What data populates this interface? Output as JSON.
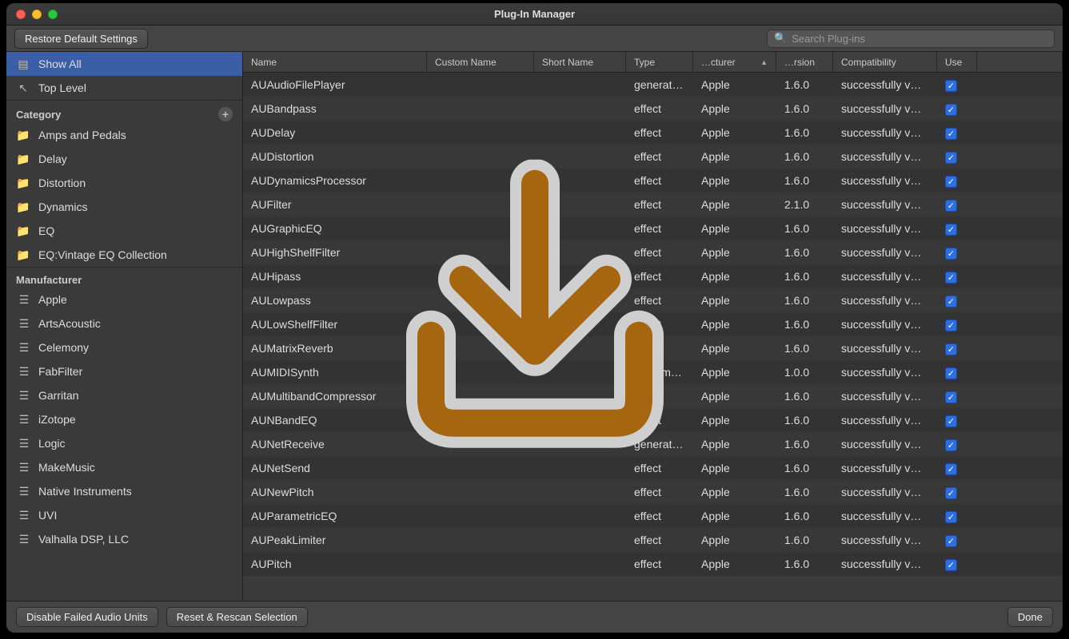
{
  "window": {
    "title": "Plug-In Manager"
  },
  "toolbar": {
    "restore_label": "Restore Default Settings",
    "search_placeholder": "Search Plug-ins"
  },
  "sidebar": {
    "top": [
      {
        "label": "Show All",
        "icon": "card-icon"
      },
      {
        "label": "Top Level",
        "icon": "up-arrow-icon"
      }
    ],
    "category_header": "Category",
    "categories": [
      "Amps and Pedals",
      "Delay",
      "Distortion",
      "Dynamics",
      "EQ",
      "EQ:Vintage EQ Collection"
    ],
    "manufacturer_header": "Manufacturer",
    "manufacturers": [
      "Apple",
      "ArtsAcoustic",
      "Celemony",
      "FabFilter",
      "Garritan",
      "iZotope",
      "Logic",
      "MakeMusic",
      "Native Instruments",
      "UVI",
      "Valhalla DSP, LLC"
    ]
  },
  "columns": {
    "name": "Name",
    "custom": "Custom Name",
    "short": "Short Name",
    "type": "Type",
    "man": "…cturer",
    "ver": "…rsion",
    "compat": "Compatibility",
    "use": "Use"
  },
  "rows": [
    {
      "name": "AUAudioFilePlayer",
      "type": "generat…",
      "man": "Apple",
      "ver": "1.6.0",
      "compat": "successfully v…",
      "use": true
    },
    {
      "name": "AUBandpass",
      "type": "effect",
      "man": "Apple",
      "ver": "1.6.0",
      "compat": "successfully v…",
      "use": true
    },
    {
      "name": "AUDelay",
      "type": "effect",
      "man": "Apple",
      "ver": "1.6.0",
      "compat": "successfully v…",
      "use": true
    },
    {
      "name": "AUDistortion",
      "type": "effect",
      "man": "Apple",
      "ver": "1.6.0",
      "compat": "successfully v…",
      "use": true
    },
    {
      "name": "AUDynamicsProcessor",
      "type": "effect",
      "man": "Apple",
      "ver": "1.6.0",
      "compat": "successfully v…",
      "use": true
    },
    {
      "name": "AUFilter",
      "type": "effect",
      "man": "Apple",
      "ver": "2.1.0",
      "compat": "successfully v…",
      "use": true
    },
    {
      "name": "AUGraphicEQ",
      "type": "effect",
      "man": "Apple",
      "ver": "1.6.0",
      "compat": "successfully v…",
      "use": true
    },
    {
      "name": "AUHighShelfFilter",
      "type": "effect",
      "man": "Apple",
      "ver": "1.6.0",
      "compat": "successfully v…",
      "use": true
    },
    {
      "name": "AUHipass",
      "type": "effect",
      "man": "Apple",
      "ver": "1.6.0",
      "compat": "successfully v…",
      "use": true
    },
    {
      "name": "AULowpass",
      "type": "effect",
      "man": "Apple",
      "ver": "1.6.0",
      "compat": "successfully v…",
      "use": true
    },
    {
      "name": "AULowShelfFilter",
      "type": "effect",
      "man": "Apple",
      "ver": "1.6.0",
      "compat": "successfully v…",
      "use": true
    },
    {
      "name": "AUMatrixReverb",
      "type": "effect",
      "man": "Apple",
      "ver": "1.6.0",
      "compat": "successfully v…",
      "use": true
    },
    {
      "name": "AUMIDISynth",
      "type": "instrum…",
      "man": "Apple",
      "ver": "1.0.0",
      "compat": "successfully v…",
      "use": true
    },
    {
      "name": "AUMultibandCompressor",
      "type": "effect",
      "man": "Apple",
      "ver": "1.6.0",
      "compat": "successfully v…",
      "use": true
    },
    {
      "name": "AUNBandEQ",
      "type": "effect",
      "man": "Apple",
      "ver": "1.6.0",
      "compat": "successfully v…",
      "use": true
    },
    {
      "name": "AUNetReceive",
      "type": "generat…",
      "man": "Apple",
      "ver": "1.6.0",
      "compat": "successfully v…",
      "use": true
    },
    {
      "name": "AUNetSend",
      "type": "effect",
      "man": "Apple",
      "ver": "1.6.0",
      "compat": "successfully v…",
      "use": true
    },
    {
      "name": "AUNewPitch",
      "type": "effect",
      "man": "Apple",
      "ver": "1.6.0",
      "compat": "successfully v…",
      "use": true
    },
    {
      "name": "AUParametricEQ",
      "type": "effect",
      "man": "Apple",
      "ver": "1.6.0",
      "compat": "successfully v…",
      "use": true
    },
    {
      "name": "AUPeakLimiter",
      "type": "effect",
      "man": "Apple",
      "ver": "1.6.0",
      "compat": "successfully v…",
      "use": true
    },
    {
      "name": "AUPitch",
      "type": "effect",
      "man": "Apple",
      "ver": "1.6.0",
      "compat": "successfully v…",
      "use": true
    }
  ],
  "footer": {
    "disable_label": "Disable Failed Audio Units",
    "rescan_label": "Reset & Rescan Selection",
    "done_label": "Done"
  }
}
